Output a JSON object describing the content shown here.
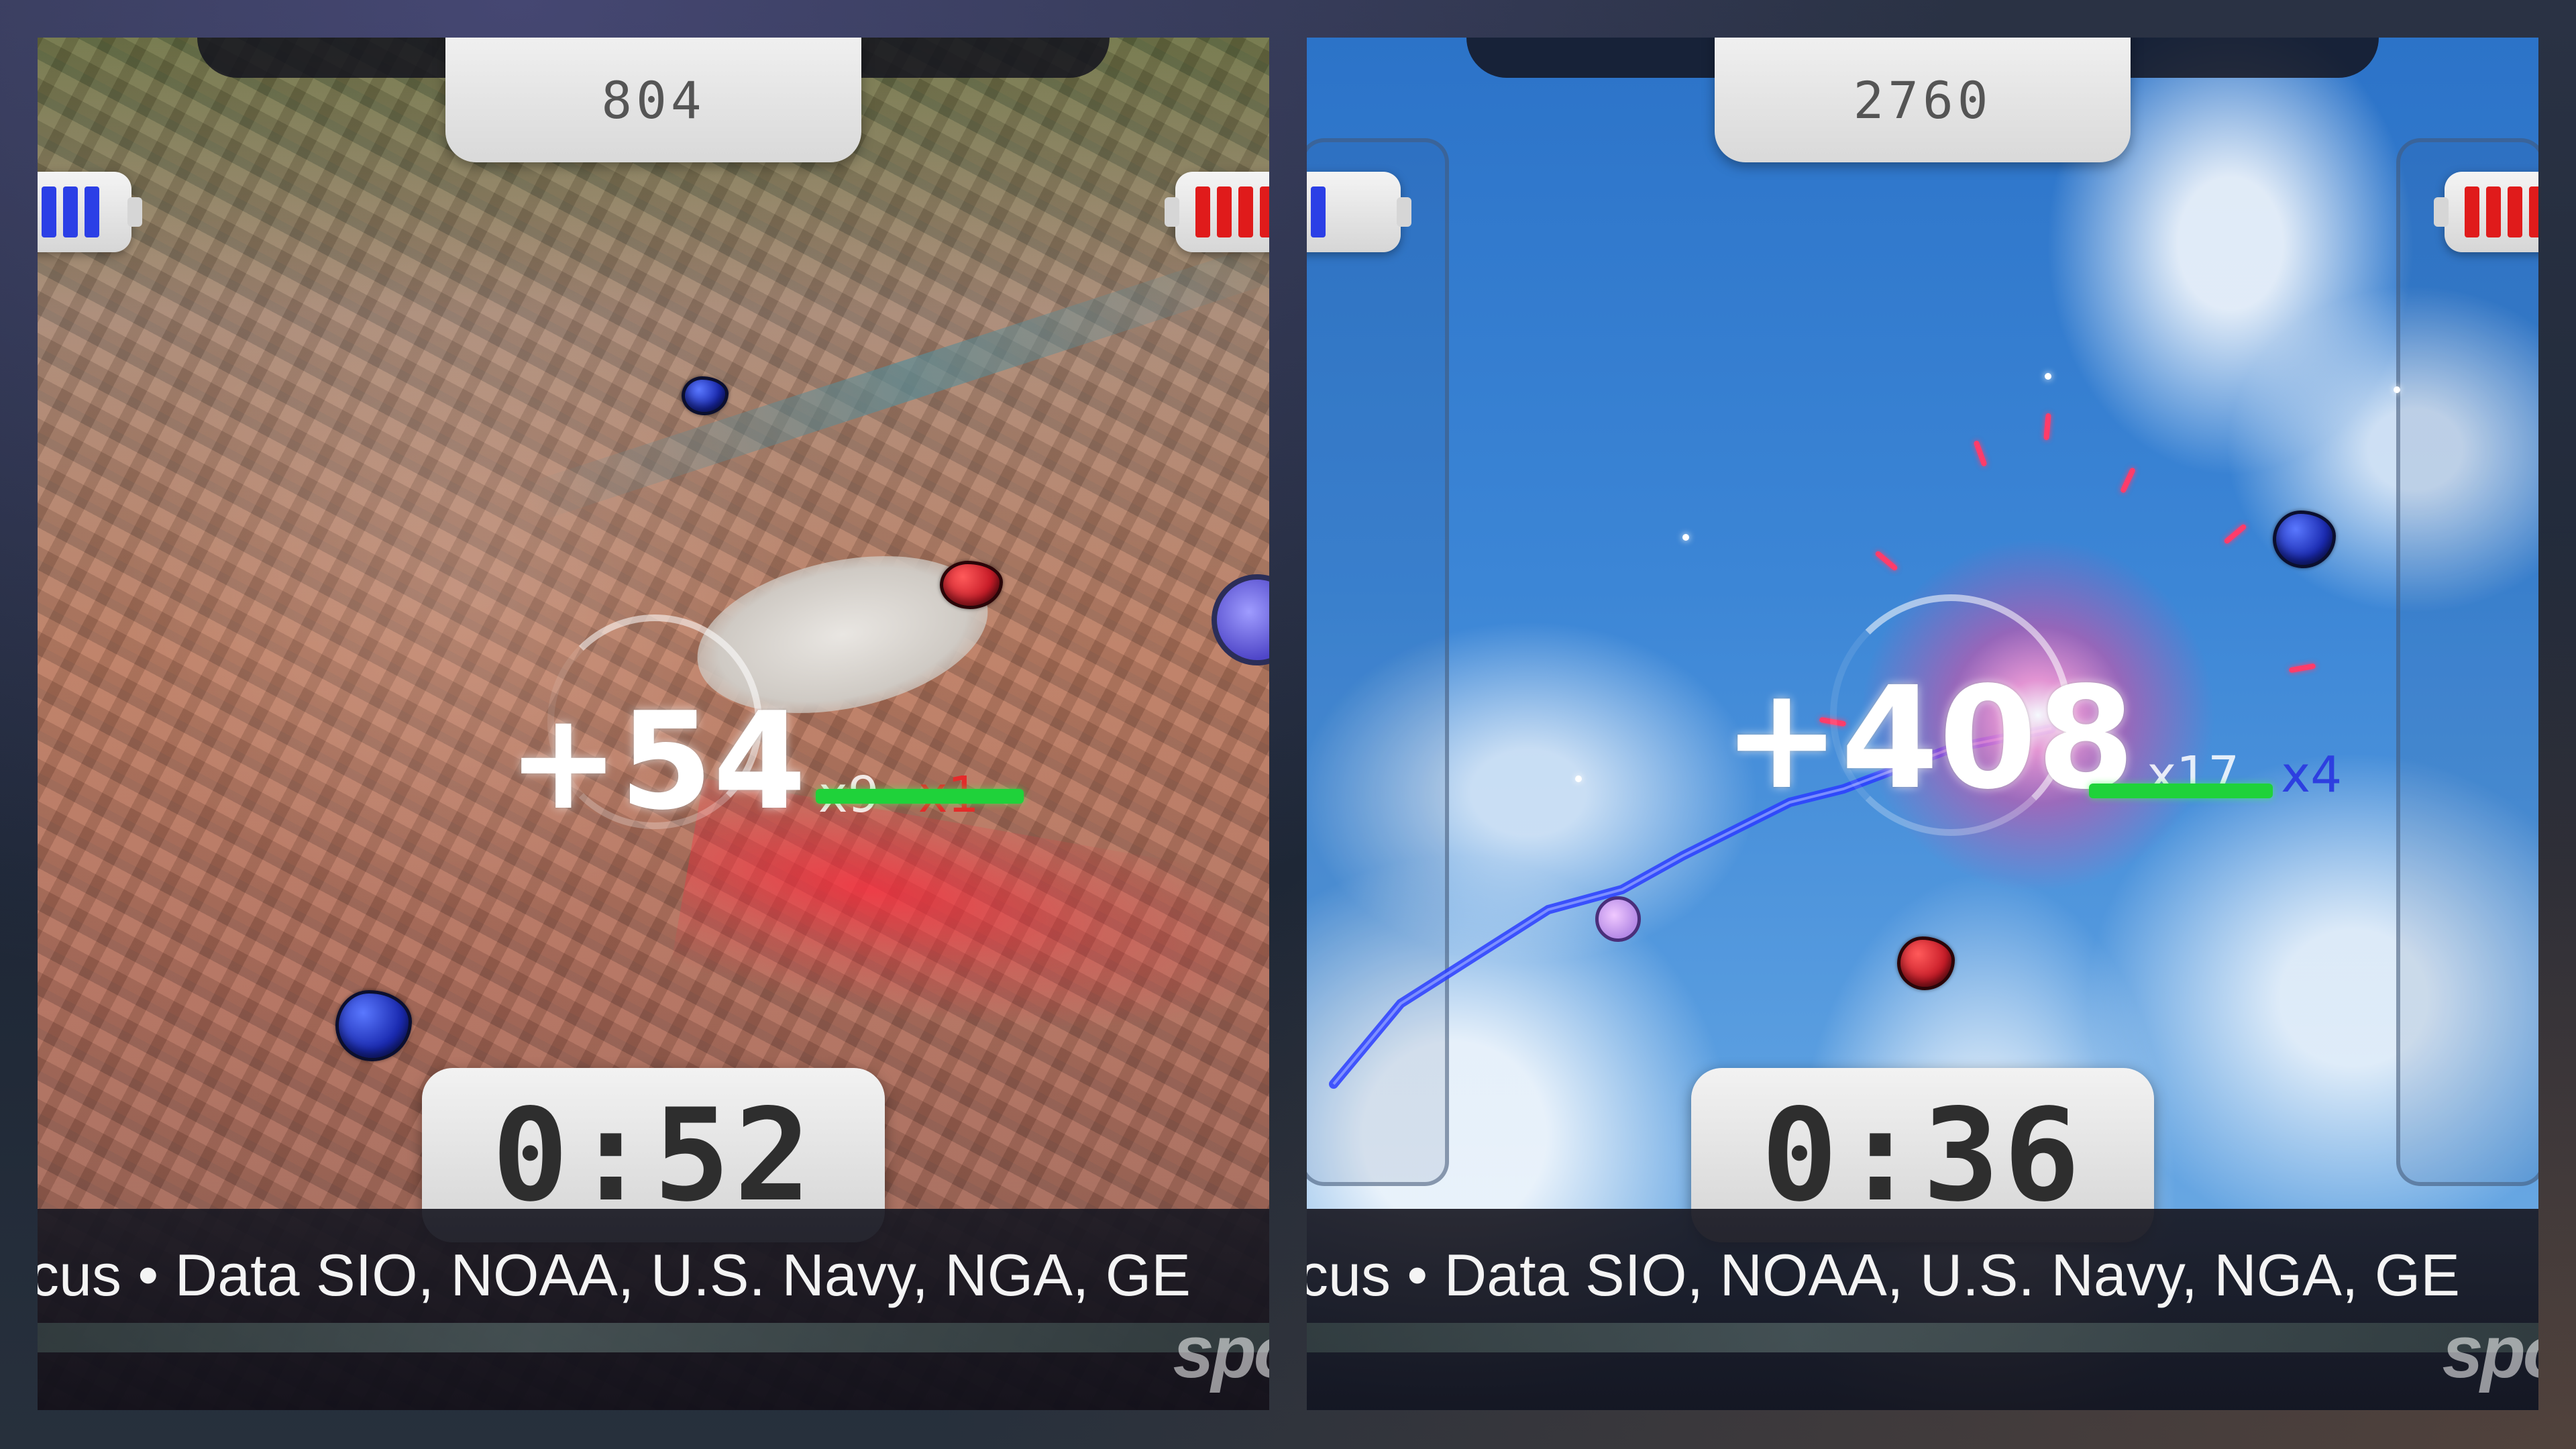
{
  "panels": [
    {
      "scene": "city",
      "score": "804",
      "timer": "0:52",
      "points_popup": "+54",
      "combo_label": "x9",
      "multiplier_label": "x1",
      "combo_progress": 0.55,
      "left_battery": {
        "color": "#2b3fe6",
        "cells_filled": 3,
        "cells_total": 4
      },
      "right_battery": {
        "color": "#e01b1b",
        "cells_filled": 4,
        "cells_total": 4
      },
      "ticker_text": "cus  •  Data SIO, NOAA, U.S. Navy, NGA, GE",
      "logo_text": "spo"
    },
    {
      "scene": "sky",
      "score": "2760",
      "timer": "0:36",
      "points_popup": "+408",
      "combo_label": "x17",
      "multiplier_label": "x4",
      "combo_progress": 0.55,
      "left_battery": {
        "color": "#2b3fe6",
        "cells_filled": 1,
        "cells_total": 4
      },
      "right_battery": {
        "color": "#e01b1b",
        "cells_filled": 4,
        "cells_total": 4
      },
      "ticker_text": "cus  •  Data SIO, NOAA, U.S. Navy, NGA, GE",
      "logo_text": "spo"
    }
  ],
  "icons": [
    "battery-icon",
    "target-reticle-icon"
  ],
  "colors": {
    "combo_bar": "#1fd23a",
    "multiplier_left": "#e52a2a",
    "multiplier_right": "#2d3fe0"
  }
}
